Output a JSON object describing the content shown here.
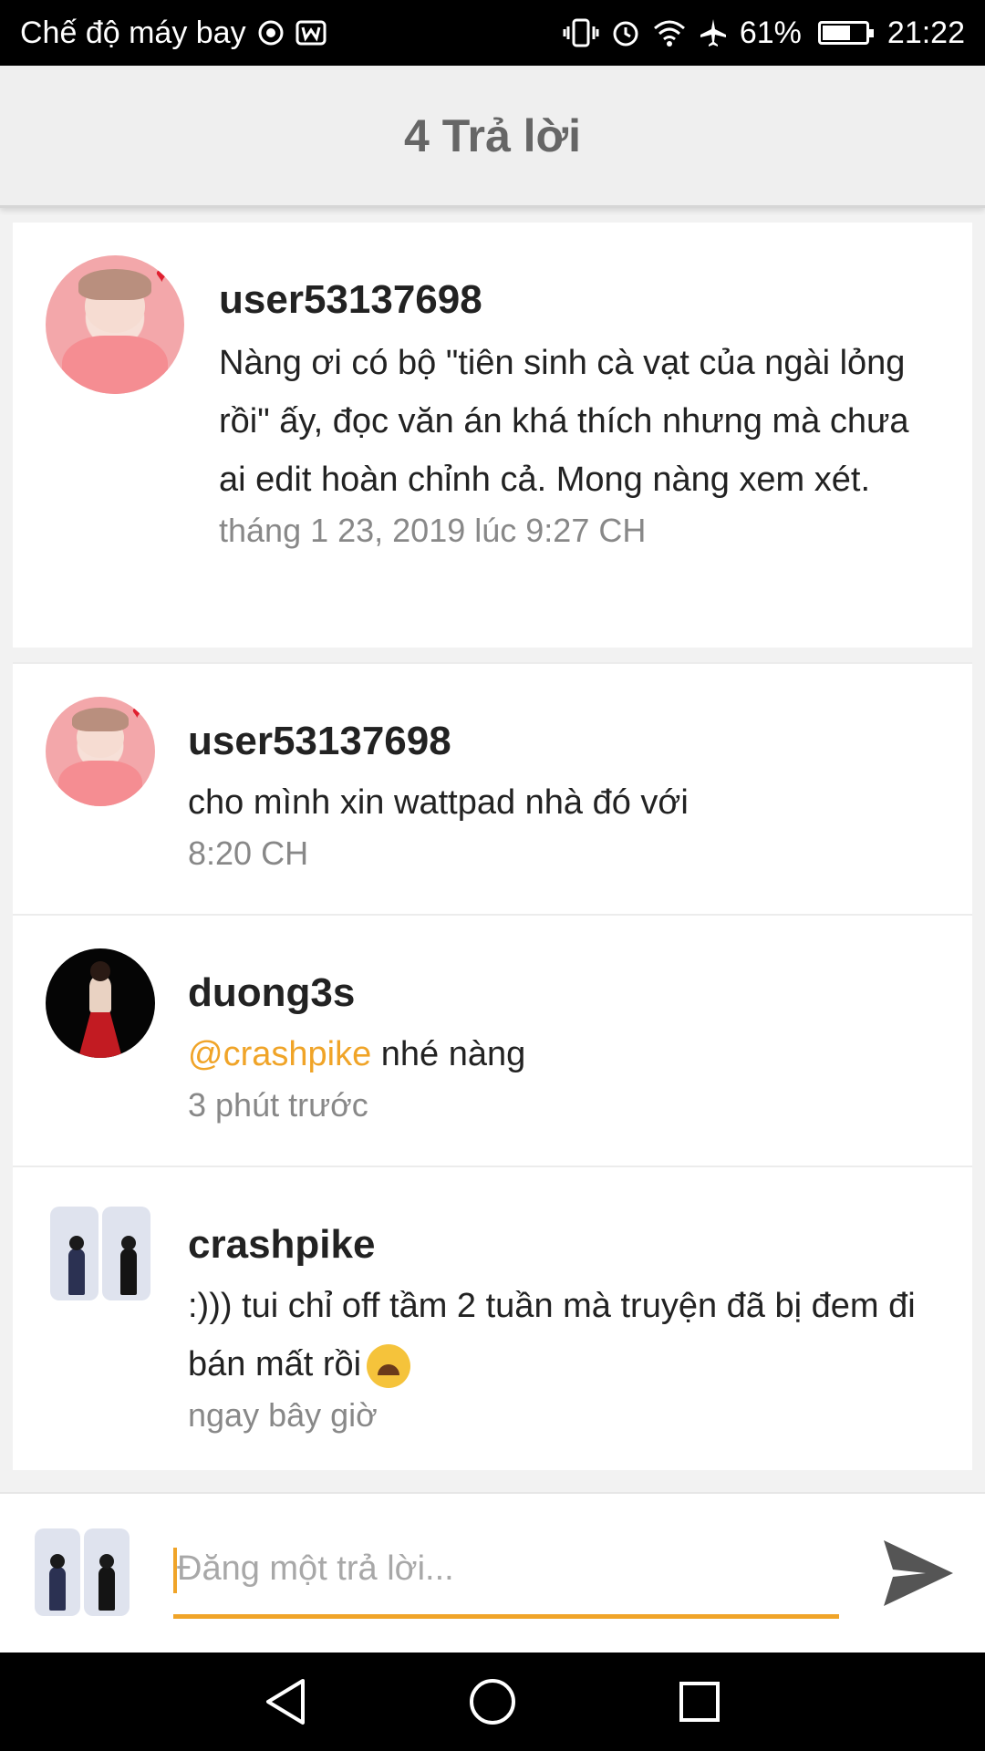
{
  "status_bar": {
    "left_text": "Chế độ máy bay",
    "battery": "61%",
    "time": "21:22"
  },
  "header": {
    "title": "4 Trả lời"
  },
  "parent_comment": {
    "username": "user53137698",
    "text": "Nàng ơi có bộ \"tiên sinh cà vạt của ngài lỏng rồi\" ấy, đọc văn án khá thích nhưng mà chưa ai edit hoàn chỉnh cả. Mong nàng xem xét.",
    "timestamp": "tháng 1 23, 2019 lúc 9:27 CH"
  },
  "replies": [
    {
      "username": "user53137698",
      "text": "cho mình xin wattpad nhà đó với",
      "timestamp": "8:20 CH"
    },
    {
      "username": "duong3s",
      "mention": "@crashpike",
      "text": " nhé nàng",
      "timestamp": "3 phút trước"
    },
    {
      "username": "crashpike",
      "text": ":))) tui chỉ off tầm 2 tuần mà truyện đã bị đem đi bán mất rồi",
      "emoji": "sad-face-emoji",
      "timestamp": "ngay bây giờ"
    }
  ],
  "input": {
    "placeholder": "Đăng một trả lời..."
  },
  "colors": {
    "accent": "#f0a428",
    "text": "#222222",
    "muted": "#888888"
  },
  "icons": [
    "airplane-icon",
    "wifi-icon",
    "alarm-icon",
    "vibrate-icon",
    "battery-icon",
    "send-icon",
    "back-icon",
    "home-icon",
    "recents-icon"
  ]
}
